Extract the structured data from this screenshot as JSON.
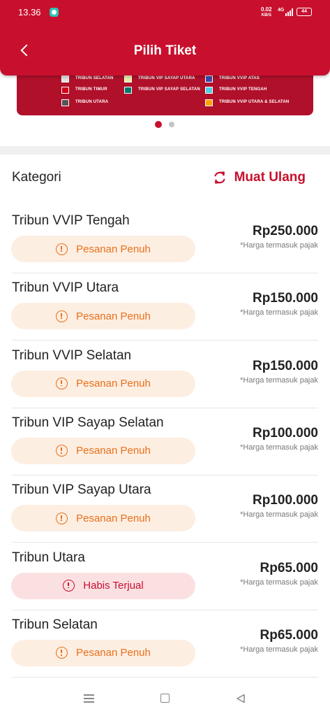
{
  "status_bar": {
    "time": "13.36",
    "net_speed_value": "0.02",
    "net_speed_unit": "KB/S",
    "network": "4G",
    "battery": "44"
  },
  "header": {
    "title": "Pilih Tiket",
    "back_icon": "chevron-left-icon",
    "color": "#c8102e"
  },
  "banner": {
    "legend": [
      {
        "label": "TRIBUN SELATAN",
        "color": "#e0e0e0"
      },
      {
        "label": "TRIBUN TIMUR",
        "color": "#d0021b"
      },
      {
        "label": "TRIBUN UTARA",
        "color": "#555555"
      },
      {
        "label": "TRIBUN VIP SAYAP UTARA",
        "color": "#e6ee9c"
      },
      {
        "label": "TRIBUN VIP SAYAP SELATAN",
        "color": "#00796b"
      },
      {
        "label": "TRIBUN VVIP ATAS",
        "color": "#3949ab"
      },
      {
        "label": "TRIBUN VVIP TENGAH",
        "color": "#4dd0e1"
      },
      {
        "label": "TRIBUN VVIP UTARA & SELATAN",
        "color": "#ffa000"
      }
    ],
    "pagination": {
      "active": 1,
      "total": 2
    }
  },
  "list_header": {
    "title": "Kategori",
    "reload_label": "Muat Ulang",
    "reload_icon": "refresh-icon"
  },
  "tickets": [
    {
      "name": "Tribun VVIP Tengah",
      "status": "Pesanan Penuh",
      "status_type": "full",
      "price": "Rp250.000",
      "note": "*Harga termasuk pajak"
    },
    {
      "name": "Tribun VVIP Utara",
      "status": "Pesanan Penuh",
      "status_type": "full",
      "price": "Rp150.000",
      "note": "*Harga termasuk pajak"
    },
    {
      "name": "Tribun VVIP Selatan",
      "status": "Pesanan Penuh",
      "status_type": "full",
      "price": "Rp150.000",
      "note": "*Harga termasuk pajak"
    },
    {
      "name": "Tribun VIP Sayap Selatan",
      "status": "Pesanan Penuh",
      "status_type": "full",
      "price": "Rp100.000",
      "note": "*Harga termasuk pajak"
    },
    {
      "name": "Tribun VIP Sayap Utara",
      "status": "Pesanan Penuh",
      "status_type": "full",
      "price": "Rp100.000",
      "note": "*Harga termasuk pajak"
    },
    {
      "name": "Tribun Utara",
      "status": "Habis Terjual",
      "status_type": "sold",
      "price": "Rp65.000",
      "note": "*Harga termasuk pajak"
    },
    {
      "name": "Tribun Selatan",
      "status": "Pesanan Penuh",
      "status_type": "full",
      "price": "Rp65.000",
      "note": "*Harga termasuk pajak"
    }
  ],
  "colors": {
    "primary": "#c8102e",
    "full_bg": "#fdeee2",
    "full_text": "#e8701a",
    "sold_bg": "#fbe0e2",
    "sold_text": "#c8102e",
    "dot_active": "#c8102e",
    "dot_inactive": "#c4c4c4"
  },
  "nav_bar": {
    "icons": [
      "menu-icon",
      "home-square-icon",
      "back-triangle-icon"
    ]
  }
}
